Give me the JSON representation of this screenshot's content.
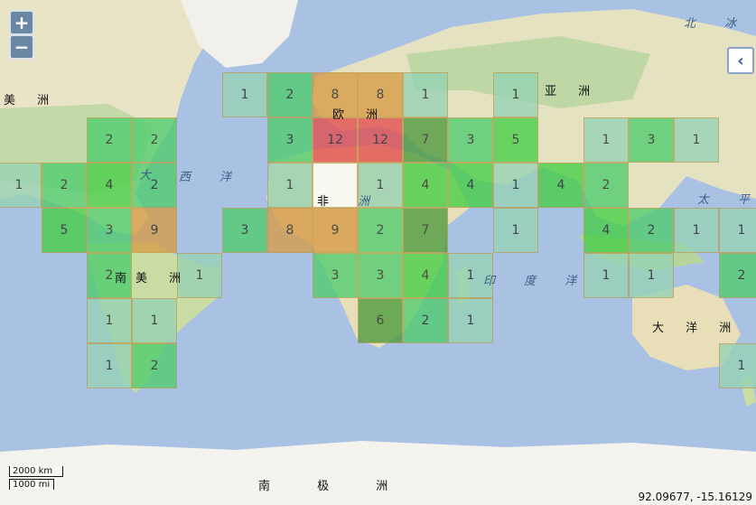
{
  "controls": {
    "zoom_in": "+",
    "zoom_out": "−",
    "layer_switcher": "‹"
  },
  "scale_bar": {
    "metric": "2000 km",
    "imperial": "1000 mi"
  },
  "coordinates": "92.09677, -15.16129",
  "labels": {
    "north_america": "美 洲",
    "europe": "欧 洲",
    "asia": "亚 洲",
    "africa": "非",
    "africa_2": "洲",
    "south_america_1": "南",
    "south_america_2": "美 洲",
    "oceania": "大 洋 洲",
    "antarctica": "南 极 洲",
    "atlantic_1": "大",
    "atlantic_2": "西 洋",
    "indian": "印 度 洋",
    "pacific": "太 平",
    "arctic": "北 冰"
  },
  "colors": {
    "ocean": "#a9c1e3",
    "land": "#ede6c8",
    "cell_low": "#96d2b4",
    "cell_green": "#46cf46",
    "cell_darkgreen": "#4c9a3c",
    "cell_orange": "#d79b46",
    "cell_red": "#e24d4d",
    "cell_white": "#ffffff"
  },
  "grid_cells": [
    {
      "col": 5,
      "row": 1,
      "value": "1",
      "color": "#96d2b4"
    },
    {
      "col": 6,
      "row": 1,
      "value": "2",
      "color": "#4fcc6e"
    },
    {
      "col": 7,
      "row": 1,
      "value": "8",
      "color": "#d79b46"
    },
    {
      "col": 8,
      "row": 1,
      "value": "8",
      "color": "#d79b46"
    },
    {
      "col": 9,
      "row": 1,
      "value": "1",
      "color": "#96d2b4"
    },
    {
      "col": 11,
      "row": 1,
      "value": "1",
      "color": "#96d2b4"
    },
    {
      "col": 2,
      "row": 2,
      "value": "2",
      "color": "#4fcc6e"
    },
    {
      "col": 3,
      "row": 2,
      "value": "2",
      "color": "#4fcc6e"
    },
    {
      "col": 6,
      "row": 2,
      "value": "3",
      "color": "#4fcc6e"
    },
    {
      "col": 7,
      "row": 2,
      "value": "12",
      "color": "#e24d4d"
    },
    {
      "col": 8,
      "row": 2,
      "value": "12",
      "color": "#e24d4d"
    },
    {
      "col": 9,
      "row": 2,
      "value": "7",
      "color": "#4c9a3c"
    },
    {
      "col": 10,
      "row": 2,
      "value": "3",
      "color": "#4fcc6e"
    },
    {
      "col": 11,
      "row": 2,
      "value": "5",
      "color": "#46cf46"
    },
    {
      "col": 13,
      "row": 2,
      "value": "1",
      "color": "#96d2b4"
    },
    {
      "col": 14,
      "row": 2,
      "value": "3",
      "color": "#4fcc6e"
    },
    {
      "col": 15,
      "row": 2,
      "value": "1",
      "color": "#96d2b4"
    },
    {
      "col": 0,
      "row": 3,
      "value": "1",
      "color": "#96d2b4"
    },
    {
      "col": 1,
      "row": 3,
      "value": "2",
      "color": "#4fcc6e"
    },
    {
      "col": 2,
      "row": 3,
      "value": "4",
      "color": "#46cf46"
    },
    {
      "col": 3,
      "row": 3,
      "value": "2",
      "color": "#4fcc6e"
    },
    {
      "col": 6,
      "row": 3,
      "value": "1",
      "color": "#96d2b4"
    },
    {
      "col": 7,
      "row": 3,
      "value": "",
      "color": "#ffffff"
    },
    {
      "col": 8,
      "row": 3,
      "value": "1",
      "color": "#96d2b4"
    },
    {
      "col": 9,
      "row": 3,
      "value": "4",
      "color": "#46cf46"
    },
    {
      "col": 10,
      "row": 3,
      "value": "4",
      "color": "#46cf46"
    },
    {
      "col": 11,
      "row": 3,
      "value": "1",
      "color": "#96d2b4"
    },
    {
      "col": 12,
      "row": 3,
      "value": "4",
      "color": "#46cf46"
    },
    {
      "col": 13,
      "row": 3,
      "value": "2",
      "color": "#4fcc6e"
    },
    {
      "col": 1,
      "row": 4,
      "value": "5",
      "color": "#46cf46"
    },
    {
      "col": 2,
      "row": 4,
      "value": "3",
      "color": "#4fcc6e"
    },
    {
      "col": 3,
      "row": 4,
      "value": "9",
      "color": "#d79b46"
    },
    {
      "col": 5,
      "row": 4,
      "value": "3",
      "color": "#4fcc6e"
    },
    {
      "col": 6,
      "row": 4,
      "value": "8",
      "color": "#d79b46"
    },
    {
      "col": 7,
      "row": 4,
      "value": "9",
      "color": "#d79b46"
    },
    {
      "col": 8,
      "row": 4,
      "value": "2",
      "color": "#4fcc6e"
    },
    {
      "col": 9,
      "row": 4,
      "value": "7",
      "color": "#4c9a3c"
    },
    {
      "col": 11,
      "row": 4,
      "value": "1",
      "color": "#96d2b4"
    },
    {
      "col": 13,
      "row": 4,
      "value": "4",
      "color": "#46cf46"
    },
    {
      "col": 14,
      "row": 4,
      "value": "2",
      "color": "#4fcc6e"
    },
    {
      "col": 15,
      "row": 4,
      "value": "1",
      "color": "#96d2b4"
    },
    {
      "col": 16,
      "row": 4,
      "value": "1",
      "color": "#96d2b4"
    },
    {
      "col": 2,
      "row": 5,
      "value": "2",
      "color": "#4fcc6e"
    },
    {
      "col": 4,
      "row": 5,
      "value": "1",
      "color": "#96d2b4"
    },
    {
      "col": 7,
      "row": 5,
      "value": "3",
      "color": "#4fcc6e"
    },
    {
      "col": 8,
      "row": 5,
      "value": "3",
      "color": "#4fcc6e"
    },
    {
      "col": 9,
      "row": 5,
      "value": "4",
      "color": "#46cf46"
    },
    {
      "col": 10,
      "row": 5,
      "value": "1",
      "color": "#96d2b4"
    },
    {
      "col": 13,
      "row": 5,
      "value": "1",
      "color": "#96d2b4"
    },
    {
      "col": 14,
      "row": 5,
      "value": "1",
      "color": "#96d2b4"
    },
    {
      "col": 16,
      "row": 5,
      "value": "2",
      "color": "#4fcc6e"
    },
    {
      "col": 2,
      "row": 6,
      "value": "1",
      "color": "#96d2b4"
    },
    {
      "col": 3,
      "row": 6,
      "value": "1",
      "color": "#96d2b4"
    },
    {
      "col": 8,
      "row": 6,
      "value": "6",
      "color": "#4c9a3c"
    },
    {
      "col": 9,
      "row": 6,
      "value": "2",
      "color": "#4fcc6e"
    },
    {
      "col": 10,
      "row": 6,
      "value": "1",
      "color": "#96d2b4"
    },
    {
      "col": 2,
      "row": 7,
      "value": "1",
      "color": "#96d2b4"
    },
    {
      "col": 3,
      "row": 7,
      "value": "2",
      "color": "#4fcc6e"
    },
    {
      "col": 16,
      "row": 7,
      "value": "1",
      "color": "#96d2b4"
    }
  ]
}
